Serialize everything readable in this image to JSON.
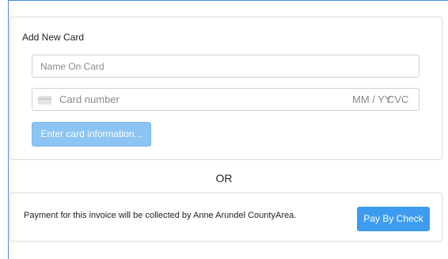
{
  "card_form": {
    "title": "Add New Card",
    "name_placeholder": "Name On Card",
    "card_number_placeholder": "Card number",
    "expiry_placeholder": "MM / YY",
    "cvc_placeholder": "CVC",
    "submit_label": "Enter card information..."
  },
  "divider": {
    "label": "OR"
  },
  "invoice": {
    "message": "Payment for this invoice will be collected by Anne Arundel CountyArea.",
    "check_button_label": "Pay By Check"
  },
  "colors": {
    "frame_border": "#4a8fd6",
    "disabled_button": "#8cc4f3",
    "primary_button": "#3d9cef"
  },
  "icons": {
    "card_field_icon": "credit-card-icon"
  }
}
